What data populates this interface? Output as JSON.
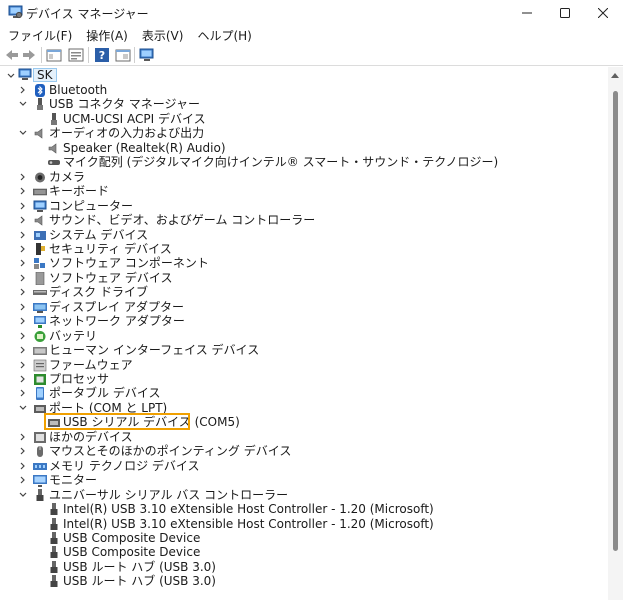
{
  "window": {
    "title": "デバイス マネージャー",
    "min_glyph": "—",
    "max_glyph": "☐",
    "close_glyph": "✕"
  },
  "menu": [
    "ファイル(F)",
    "操作(A)",
    "表示(V)",
    "ヘルプ(H)"
  ],
  "tree": {
    "root": "SK",
    "items": [
      {
        "label": "Bluetooth",
        "icon": "bluetooth-icon",
        "state": "collapsed"
      },
      {
        "label": "USB コネクタ マネージャー",
        "icon": "usb-connector-icon",
        "state": "expanded"
      },
      {
        "label": "UCM-UCSI ACPI デバイス",
        "icon": "usb-connector-icon",
        "state": "child"
      },
      {
        "label": "オーディオの入力および出力",
        "icon": "speaker-icon",
        "state": "expanded"
      },
      {
        "label": "Speaker (Realtek(R) Audio)",
        "icon": "speaker-icon",
        "state": "child"
      },
      {
        "label": "マイク配列 (デジタルマイク向けインテル® スマート・サウンド・テクノロジー)",
        "icon": "microphone-icon",
        "state": "child"
      },
      {
        "label": "カメラ",
        "icon": "camera-icon",
        "state": "collapsed"
      },
      {
        "label": "キーボード",
        "icon": "keyboard-icon",
        "state": "collapsed"
      },
      {
        "label": "コンピューター",
        "icon": "computer-icon",
        "state": "collapsed"
      },
      {
        "label": "サウンド、ビデオ、およびゲーム コントローラー",
        "icon": "speaker-icon",
        "state": "collapsed"
      },
      {
        "label": "システム デバイス",
        "icon": "system-device-icon",
        "state": "collapsed"
      },
      {
        "label": "セキュリティ デバイス",
        "icon": "security-device-icon",
        "state": "collapsed"
      },
      {
        "label": "ソフトウェア コンポーネント",
        "icon": "software-component-icon",
        "state": "collapsed"
      },
      {
        "label": "ソフトウェア デバイス",
        "icon": "software-device-icon",
        "state": "collapsed"
      },
      {
        "label": "ディスク ドライブ",
        "icon": "disk-drive-icon",
        "state": "collapsed"
      },
      {
        "label": "ディスプレイ アダプター",
        "icon": "display-adapter-icon",
        "state": "collapsed"
      },
      {
        "label": "ネットワーク アダプター",
        "icon": "network-adapter-icon",
        "state": "collapsed"
      },
      {
        "label": "バッテリ",
        "icon": "battery-icon",
        "state": "collapsed"
      },
      {
        "label": "ヒューマン インターフェイス デバイス",
        "icon": "hid-icon",
        "state": "collapsed"
      },
      {
        "label": "ファームウェア",
        "icon": "firmware-icon",
        "state": "collapsed"
      },
      {
        "label": "プロセッサ",
        "icon": "processor-icon",
        "state": "collapsed"
      },
      {
        "label": "ポータブル デバイス",
        "icon": "portable-device-icon",
        "state": "collapsed"
      },
      {
        "label": "ポート (COM と LPT)",
        "icon": "port-icon",
        "state": "expanded"
      },
      {
        "label": "USB シリアル デバイス (COM5)",
        "icon": "port-icon",
        "state": "child"
      },
      {
        "label": "ほかのデバイス",
        "icon": "other-device-icon",
        "state": "collapsed"
      },
      {
        "label": "マウスとそのほかのポインティング デバイス",
        "icon": "mouse-icon",
        "state": "collapsed"
      },
      {
        "label": "メモリ テクノロジ デバイス",
        "icon": "memory-icon",
        "state": "collapsed"
      },
      {
        "label": "モニター",
        "icon": "monitor-icon",
        "state": "collapsed"
      },
      {
        "label": "ユニバーサル シリアル バス コントローラー",
        "icon": "usb-icon",
        "state": "expanded"
      },
      {
        "label": "Intel(R) USB 3.10 eXtensible Host Controller - 1.20 (Microsoft)",
        "icon": "usb-icon",
        "state": "child"
      },
      {
        "label": "Intel(R) USB 3.10 eXtensible Host Controller - 1.20 (Microsoft)",
        "icon": "usb-icon",
        "state": "child"
      },
      {
        "label": "USB Composite Device",
        "icon": "usb-icon",
        "state": "child"
      },
      {
        "label": "USB Composite Device",
        "icon": "usb-icon",
        "state": "child"
      },
      {
        "label": "USB ルート ハブ (USB 3.0)",
        "icon": "usb-icon",
        "state": "child"
      },
      {
        "label": "USB ルート ハブ (USB 3.0)",
        "icon": "usb-icon",
        "state": "child"
      }
    ],
    "selected_index": 23,
    "highlight_color": "#f0a000"
  }
}
